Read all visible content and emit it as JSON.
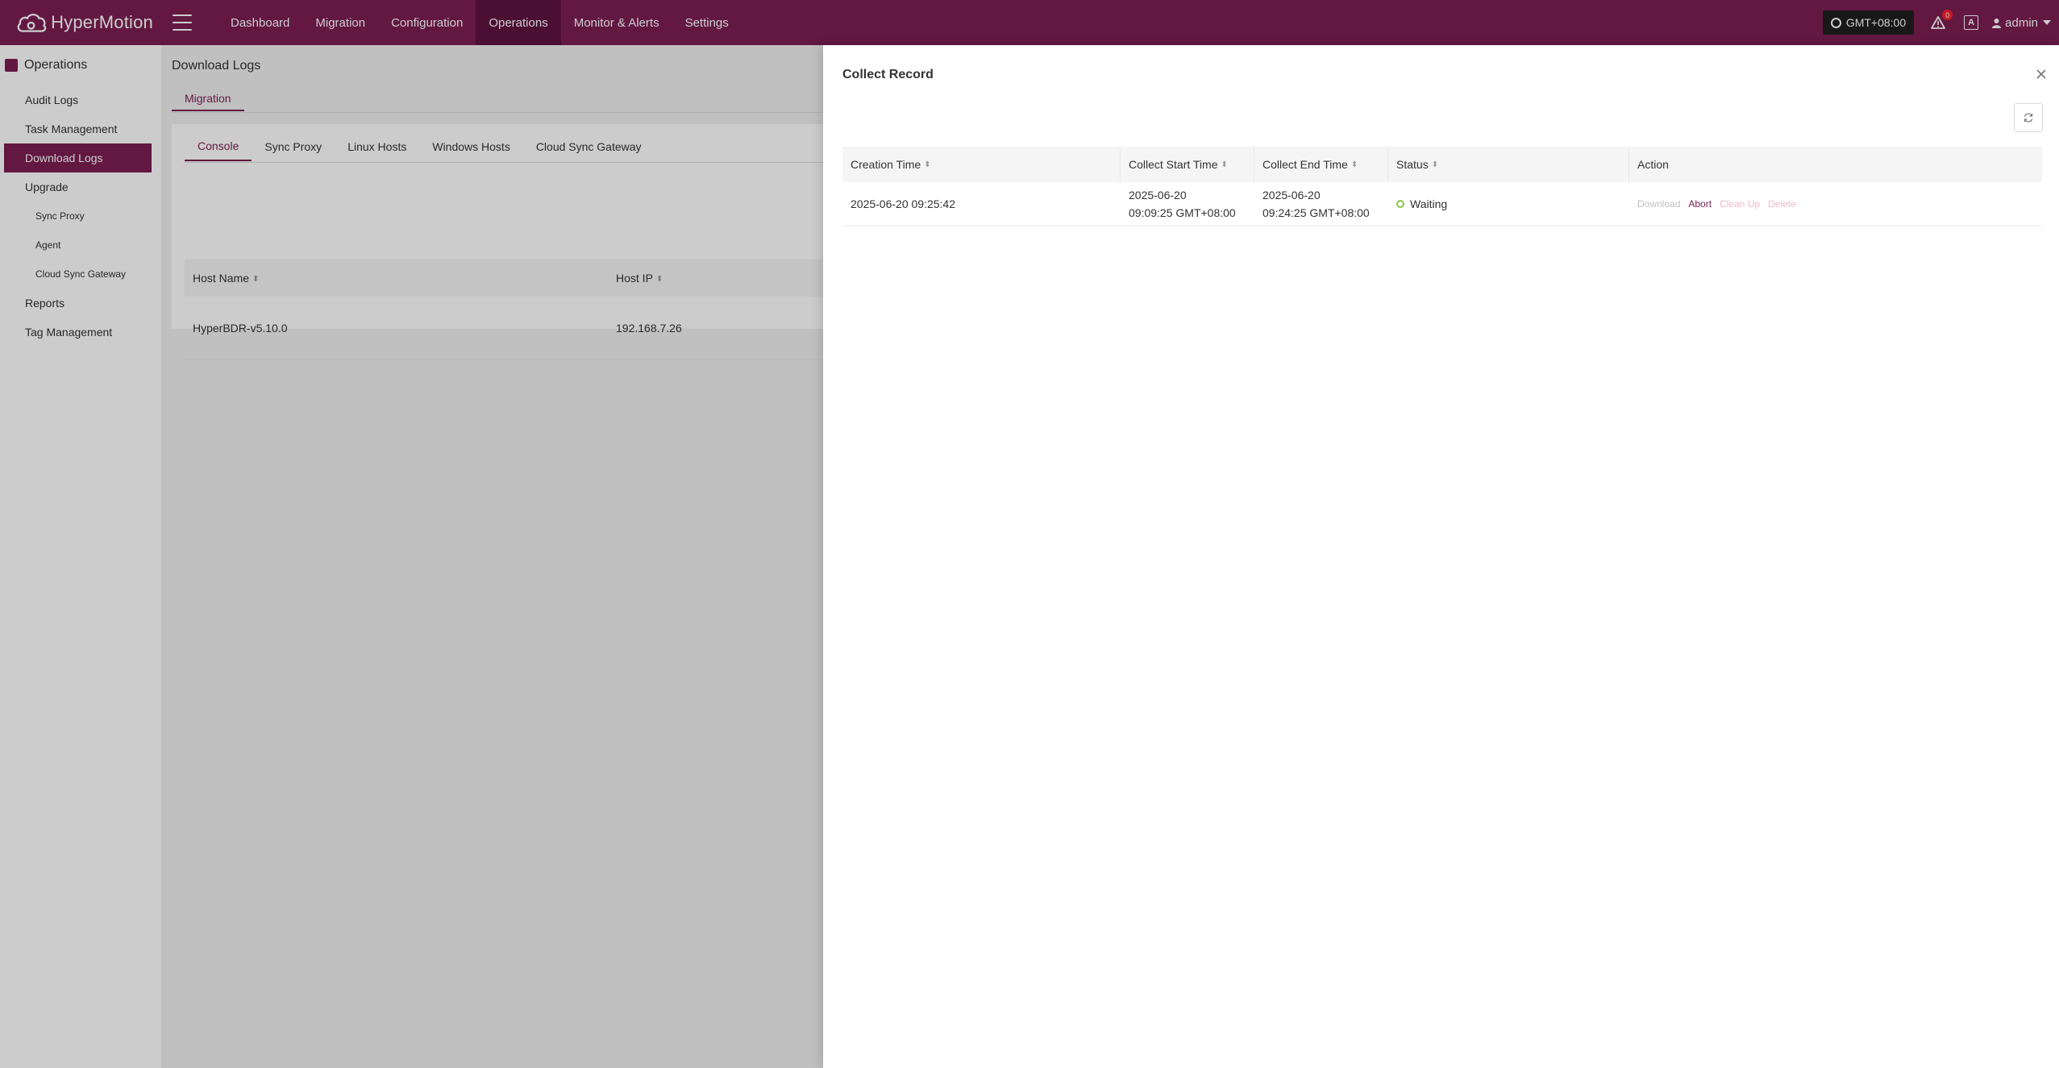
{
  "brand": {
    "name": "HyperMotion"
  },
  "nav": {
    "items": [
      {
        "label": "Dashboard"
      },
      {
        "label": "Migration"
      },
      {
        "label": "Configuration"
      },
      {
        "label": "Operations"
      },
      {
        "label": "Monitor & Alerts"
      },
      {
        "label": "Settings"
      }
    ],
    "active": "Operations"
  },
  "topbar": {
    "timezone": "GMT+08:00",
    "alert_count": "0",
    "lang_icon": "A",
    "user": "admin"
  },
  "sidebar": {
    "title": "Operations",
    "items": [
      {
        "label": "Audit Logs"
      },
      {
        "label": "Task Management"
      },
      {
        "label": "Download Logs"
      },
      {
        "label": "Upgrade"
      },
      {
        "label": "Sync Proxy"
      },
      {
        "label": "Agent"
      },
      {
        "label": "Cloud Sync Gateway"
      },
      {
        "label": "Reports"
      },
      {
        "label": "Tag Management"
      }
    ],
    "active": "Download Logs"
  },
  "main": {
    "title": "Download Logs",
    "tab": "Migration",
    "sub_tabs": [
      {
        "label": "Console"
      },
      {
        "label": "Sync Proxy"
      },
      {
        "label": "Linux Hosts"
      },
      {
        "label": "Windows Hosts"
      },
      {
        "label": "Cloud Sync Gateway"
      }
    ],
    "columns": {
      "host_name": "Host Name",
      "host_ip": "Host IP"
    },
    "rows": [
      {
        "host_name": "HyperBDR-v5.10.0",
        "host_ip": "192.168.7.26"
      }
    ]
  },
  "drawer": {
    "title": "Collect Record",
    "columns": {
      "creation_time": "Creation Time",
      "start_time": "Collect Start Time",
      "end_time": "Collect End Time",
      "status": "Status",
      "action": "Action"
    },
    "rows": [
      {
        "creation_time": "2025-06-20 09:25:42",
        "start_date": "2025-06-20",
        "start_time": "09:09:25 GMT+08:00",
        "end_date": "2025-06-20",
        "end_time": "09:24:25 GMT+08:00",
        "status": "Waiting",
        "actions": {
          "download": "Download",
          "abort": "Abort",
          "cleanup": "Clean Up",
          "delete": "Delete"
        }
      }
    ]
  },
  "colors": {
    "brand": "#7b1f52",
    "status_waiting": "#8bc34a"
  }
}
